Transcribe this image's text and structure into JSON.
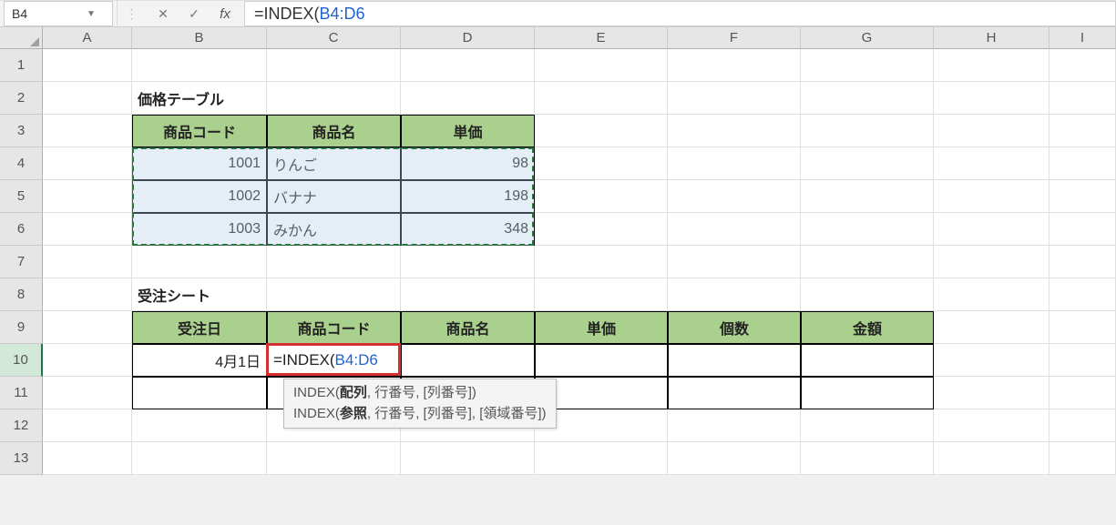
{
  "formula_bar": {
    "name_box": "B4",
    "cancel_glyph": "✕",
    "enter_glyph": "✓",
    "fx_label": "fx",
    "formula_prefix": "=INDEX(",
    "formula_ref": "B4:D6"
  },
  "columns": [
    "A",
    "B",
    "C",
    "D",
    "E",
    "F",
    "G",
    "H",
    "I"
  ],
  "rows": [
    "1",
    "2",
    "3",
    "4",
    "5",
    "6",
    "7",
    "8",
    "9",
    "10",
    "11",
    "12",
    "13"
  ],
  "price_table": {
    "title": "価格テーブル",
    "headers": [
      "商品コード",
      "商品名",
      "単価"
    ],
    "rows": [
      {
        "code": "1001",
        "name": "りんご",
        "price": "98"
      },
      {
        "code": "1002",
        "name": "バナナ",
        "price": "198"
      },
      {
        "code": "1003",
        "name": "みかん",
        "price": "348"
      }
    ]
  },
  "order_sheet": {
    "title": "受注シート",
    "headers": [
      "受注日",
      "商品コード",
      "商品名",
      "単価",
      "個数",
      "金額"
    ],
    "rows": [
      {
        "date": "4月1日"
      }
    ]
  },
  "editing_cell": {
    "prefix": "=INDEX(",
    "ref": "B4:D6"
  },
  "tooltip": {
    "line1_fn": "INDEX",
    "line1_bold": "配列",
    "line1_rest": ", 行番号, [列番号])",
    "line2_fn": "INDEX",
    "line2_bold": "参照",
    "line2_rest": ", 行番号, [列番号], [領域番号])"
  },
  "chart_data": {
    "type": "table",
    "title": "価格テーブル",
    "columns": [
      "商品コード",
      "商品名",
      "単価"
    ],
    "rows": [
      [
        1001,
        "りんご",
        98
      ],
      [
        1002,
        "バナナ",
        198
      ],
      [
        1003,
        "みかん",
        348
      ]
    ]
  }
}
